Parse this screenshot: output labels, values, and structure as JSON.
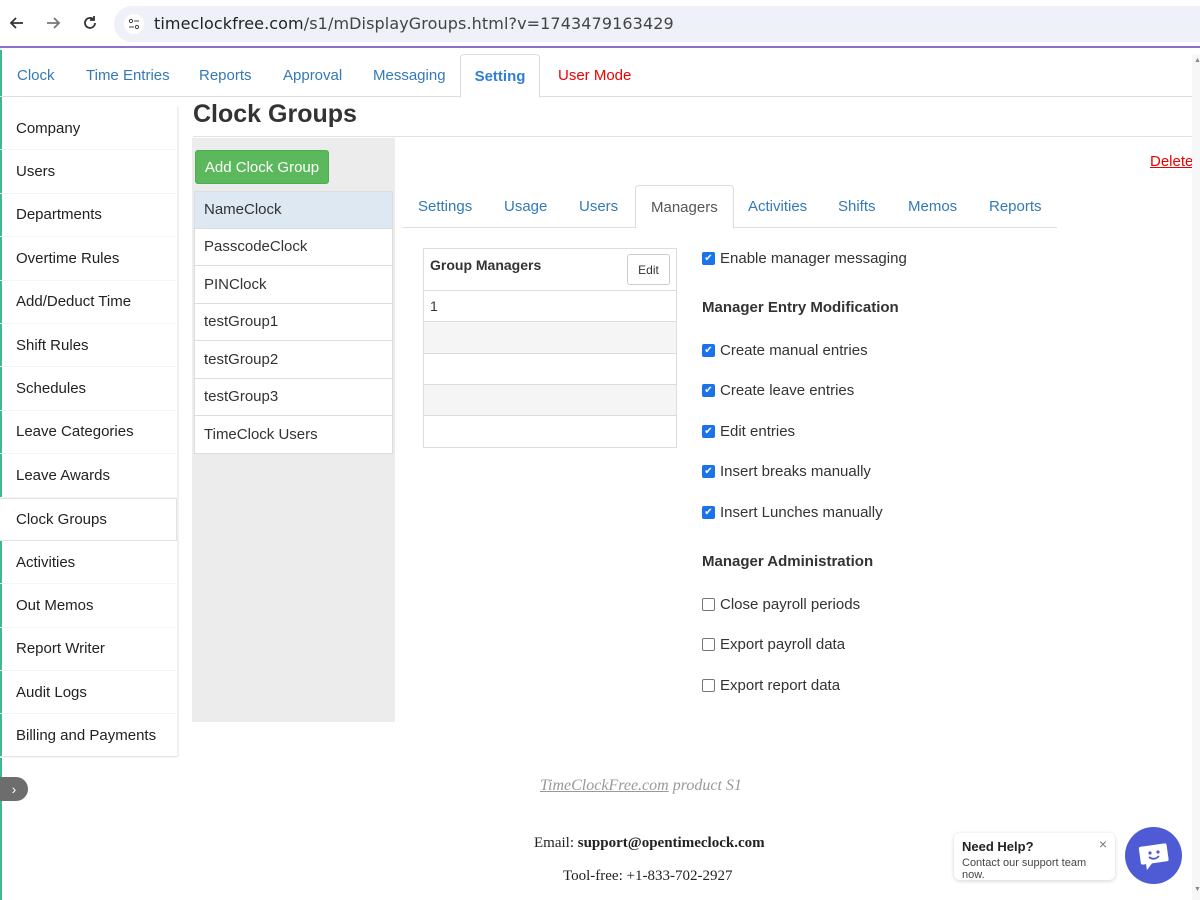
{
  "browser": {
    "url_host": "timeclockfree.com",
    "url_path": "/s1/mDisplayGroups.html?v=1743479163429"
  },
  "top_nav": {
    "tabs": [
      {
        "label": "Clock"
      },
      {
        "label": "Time Entries"
      },
      {
        "label": "Reports"
      },
      {
        "label": "Approval"
      },
      {
        "label": "Messaging"
      },
      {
        "label": "Setting"
      },
      {
        "label": "User Mode"
      }
    ]
  },
  "sidebar": {
    "items": [
      {
        "label": "Company"
      },
      {
        "label": "Users"
      },
      {
        "label": "Departments"
      },
      {
        "label": "Overtime Rules"
      },
      {
        "label": "Add/Deduct Time"
      },
      {
        "label": "Shift Rules"
      },
      {
        "label": "Schedules"
      },
      {
        "label": "Leave Categories"
      },
      {
        "label": "Leave Awards"
      },
      {
        "label": "Clock Groups"
      },
      {
        "label": "Activities"
      },
      {
        "label": "Out Memos"
      },
      {
        "label": "Report Writer"
      },
      {
        "label": "Audit Logs"
      },
      {
        "label": "Billing and Payments"
      }
    ],
    "collapse_glyph": "›"
  },
  "page": {
    "title": "Clock Groups",
    "add_button": "Add Clock Group",
    "delete_link": "Delete"
  },
  "groups": [
    {
      "label": "NameClock"
    },
    {
      "label": "PasscodeClock"
    },
    {
      "label": "PINClock"
    },
    {
      "label": "testGroup1"
    },
    {
      "label": "testGroup2"
    },
    {
      "label": "testGroup3"
    },
    {
      "label": "TimeClock Users"
    }
  ],
  "inner_tabs": [
    {
      "label": "Settings"
    },
    {
      "label": "Usage"
    },
    {
      "label": "Users"
    },
    {
      "label": "Managers"
    },
    {
      "label": "Activities"
    },
    {
      "label": "Shifts"
    },
    {
      "label": "Memos"
    },
    {
      "label": "Reports"
    }
  ],
  "managers_table": {
    "header": "Group Managers",
    "edit_label": "Edit",
    "rows": [
      "1",
      "",
      "",
      "",
      ""
    ]
  },
  "options": {
    "enable_messaging": {
      "label": "Enable manager messaging",
      "checked": true
    },
    "entry_section": "Manager Entry Modification",
    "entry": [
      {
        "label": "Create manual entries",
        "checked": true
      },
      {
        "label": "Create leave entries",
        "checked": true
      },
      {
        "label": "Edit entries",
        "checked": true
      },
      {
        "label": "Insert breaks manually",
        "checked": true
      },
      {
        "label": "Insert Lunches manually",
        "checked": true
      }
    ],
    "admin_section": "Manager Administration",
    "admin": [
      {
        "label": "Close payroll periods",
        "checked": false
      },
      {
        "label": "Export payroll data",
        "checked": false
      },
      {
        "label": "Export report data",
        "checked": false
      }
    ]
  },
  "footer": {
    "product_link": "TimeClockFree.com",
    "product_suffix": " product S1",
    "email_label": "Email: ",
    "email": "support@opentimeclock.com",
    "phone": "Tool-free: +1-833-702-2927"
  },
  "help": {
    "title": "Need Help?",
    "subtitle": "Contact our support team now.",
    "close": "×"
  },
  "colors": {
    "link": "#337ab7",
    "danger": "#e00000",
    "success": "#5cb85c",
    "checkbox": "#1a73e8",
    "help_bubble": "#4f5bd5"
  }
}
